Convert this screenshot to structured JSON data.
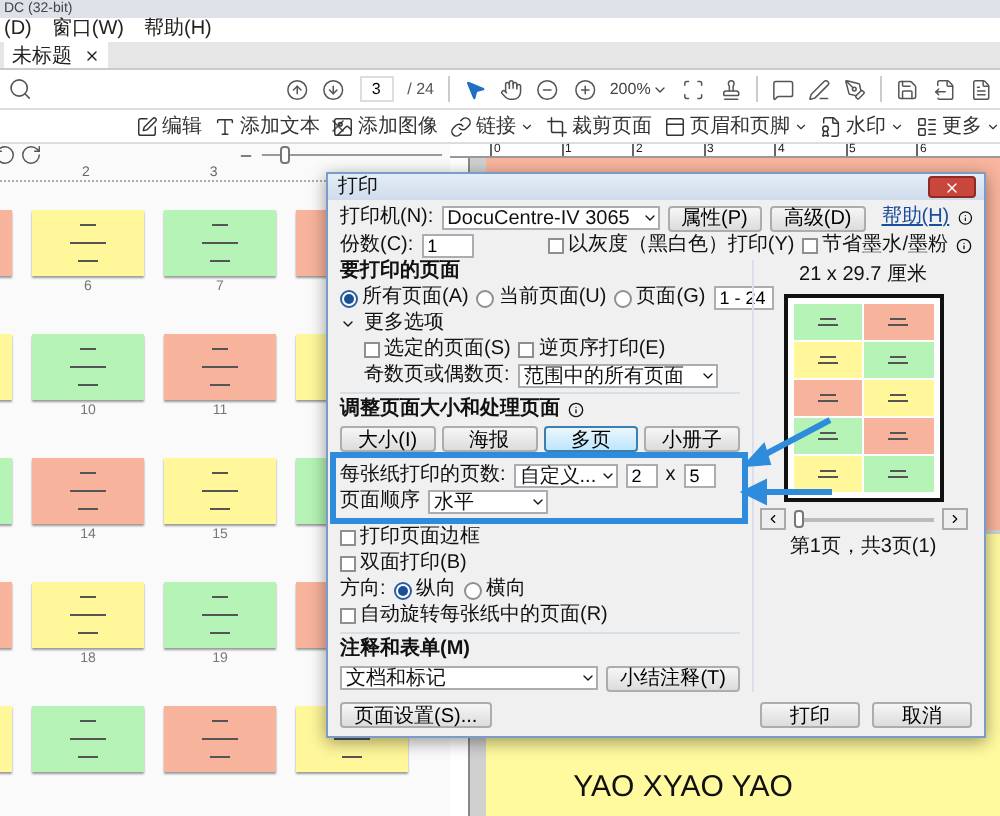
{
  "window": {
    "title": "DC (32-bit)"
  },
  "menu": [
    {
      "label": "(D)"
    },
    {
      "label": "窗口(W)"
    },
    {
      "label": "帮助(H)"
    }
  ],
  "tabs": [
    {
      "label": "未标题",
      "selected": true
    }
  ],
  "toolbar": {
    "page": "3",
    "page_count": "/ 24",
    "zoom": "200%"
  },
  "edit_tools": [
    {
      "label": "编辑",
      "dropdown": false
    },
    {
      "label": "添加文本",
      "dropdown": false
    },
    {
      "label": "添加图像",
      "dropdown": false
    },
    {
      "label": "链接",
      "dropdown": true
    },
    {
      "label": "裁剪页面",
      "dropdown": false
    },
    {
      "label": "页眉和页脚",
      "dropdown": true
    },
    {
      "label": "水印",
      "dropdown": true
    },
    {
      "label": "更多",
      "dropdown": true
    }
  ],
  "thumbnails": {
    "size_slider": {
      "level": 0.1
    },
    "ruler": [
      "2",
      "3"
    ],
    "rows": [
      {
        "cards": [
          {
            "color": "#f8b39c"
          },
          {
            "color": "#fff79a",
            "label": "6"
          },
          {
            "color": "#b5f3b6",
            "label": "7"
          },
          {
            "color": "#f8b39c"
          }
        ]
      },
      {
        "cards": [
          {
            "color": "#fff79a"
          },
          {
            "color": "#b5f3b6",
            "label": "10"
          },
          {
            "color": "#f8b39c",
            "label": "11"
          },
          {
            "color": "#fff79a"
          }
        ]
      },
      {
        "cards": [
          {
            "color": "#b5f3b6"
          },
          {
            "color": "#f8b39c",
            "label": "14"
          },
          {
            "color": "#fff79a",
            "label": "15"
          },
          {
            "color": "#b5f3b6"
          }
        ]
      },
      {
        "cards": [
          {
            "color": "#f8b39c"
          },
          {
            "color": "#fff79a",
            "label": "18"
          },
          {
            "color": "#b5f3b6",
            "label": "19"
          },
          {
            "color": "#f8b39c"
          }
        ]
      },
      {
        "cards": [
          {
            "color": "#fff79a"
          },
          {
            "color": "#b5f3b6"
          },
          {
            "color": "#f8b39c"
          },
          {
            "color": "#fff79a"
          }
        ]
      }
    ]
  },
  "document": {
    "ruler": [
      "0",
      "1",
      "2",
      "3",
      "4",
      "5",
      "6"
    ],
    "pages": [
      {
        "color": "#f9b59d"
      },
      {
        "color": "#fffa9e",
        "text": "YAO XYAO YAO"
      }
    ]
  },
  "dialog": {
    "title": "打印",
    "help": "帮助(H)",
    "printer": {
      "label": "打印机(N):",
      "value": "DocuCentre-IV 3065"
    },
    "top_buttons": [
      "属性(P)",
      "高级(D)"
    ],
    "copies": {
      "label": "份数(C):",
      "value": "1"
    },
    "options": [
      {
        "label": "以灰度（黑白色）打印(Y)",
        "checked": false
      },
      {
        "label": "节省墨水/墨粉",
        "checked": false
      }
    ],
    "pages_section": {
      "title": "要打印的页面",
      "choices": [
        {
          "label": "所有页面(A)",
          "selected": true
        },
        {
          "label": "当前页面(U)",
          "selected": false
        },
        {
          "label": "页面(G)",
          "selected": false
        }
      ],
      "range": "1 - 24",
      "more": "更多选项",
      "more_options": [
        {
          "label": "选定的页面(S)",
          "checked": false
        },
        {
          "label": "逆页序打印(E)",
          "checked": false
        }
      ],
      "odd_even": {
        "label": "奇数页或偶数页:",
        "value": "范围中的所有页面"
      }
    },
    "sizing": {
      "title": "调整页面大小和处理页面",
      "modes": [
        {
          "label": "大小(I)",
          "selected": false
        },
        {
          "label": "海报",
          "selected": false
        },
        {
          "label": "多页",
          "selected": true
        },
        {
          "label": "小册子",
          "selected": false
        }
      ],
      "pages_per_sheet": {
        "label": "每张纸打印的页数:",
        "value": "自定义...",
        "columns": "2",
        "times": "x",
        "rows": "5"
      },
      "order": {
        "label": "页面顺序",
        "value": "水平"
      },
      "checks": [
        {
          "label": "打印页面边框",
          "checked": false
        },
        {
          "label": "双面打印(B)",
          "checked": false
        }
      ],
      "orientation": {
        "label": "方向:",
        "choices": [
          {
            "label": "纵向",
            "selected": true
          },
          {
            "label": "横向",
            "selected": false
          }
        ]
      },
      "auto_rotate": {
        "label": "自动旋转每张纸中的页面(R)",
        "checked": false
      }
    },
    "comments": {
      "title": "注释和表单(M)",
      "value": "文档和标记",
      "button": "小结注释(T)"
    },
    "preview": {
      "size": "21 x 29.7 厘米",
      "pages": [
        {
          "color": "#b5f3b6"
        },
        {
          "color": "#f8b39c"
        },
        {
          "color": "#fff79a"
        },
        {
          "color": "#b5f3b6"
        },
        {
          "color": "#f8b39c"
        },
        {
          "color": "#fff79a"
        },
        {
          "color": "#b5f3b6"
        },
        {
          "color": "#f8b39c"
        },
        {
          "color": "#fff79a"
        },
        {
          "color": "#b5f3b6"
        }
      ],
      "slider": {
        "level": 0
      },
      "page": "第1页，共3页(1)"
    },
    "footer": {
      "setup": "页面设置(S)...",
      "print": "打印",
      "cancel": "取消"
    }
  }
}
